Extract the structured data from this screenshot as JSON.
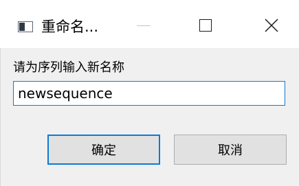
{
  "window": {
    "title": "重命名...",
    "icon": "window-icon",
    "controls": {
      "minimize_icon": "minimize-icon",
      "maximize_icon": "maximize-icon",
      "close_icon": "close-icon"
    }
  },
  "dialog": {
    "prompt": "请为序列输入新名称",
    "input_value": "newsequence",
    "ok_label": "确定",
    "cancel_label": "取消"
  },
  "colors": {
    "accent": "#0a7ad6",
    "background": "#f0f0f0",
    "titlebar": "#ffffff",
    "button": "#e1e1e1"
  }
}
